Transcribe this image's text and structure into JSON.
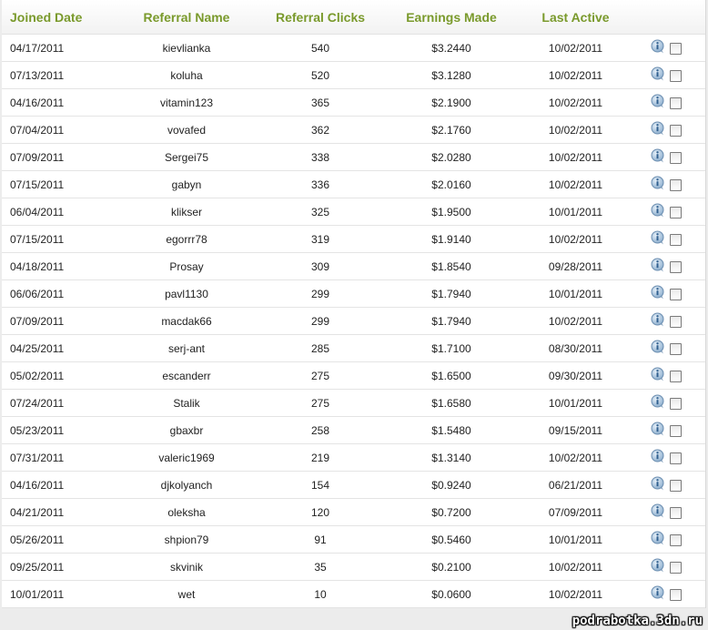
{
  "columns": {
    "joined": "Joined Date",
    "name": "Referral Name",
    "clicks": "Referral Clicks",
    "earnings": "Earnings Made",
    "active": "Last Active"
  },
  "rows": [
    {
      "joined": "04/17/2011",
      "name": "kievlianka",
      "clicks": "540",
      "earnings": "$3.2440",
      "active": "10/02/2011"
    },
    {
      "joined": "07/13/2011",
      "name": "koluha",
      "clicks": "520",
      "earnings": "$3.1280",
      "active": "10/02/2011"
    },
    {
      "joined": "04/16/2011",
      "name": "vitamin123",
      "clicks": "365",
      "earnings": "$2.1900",
      "active": "10/02/2011"
    },
    {
      "joined": "07/04/2011",
      "name": "vovafed",
      "clicks": "362",
      "earnings": "$2.1760",
      "active": "10/02/2011"
    },
    {
      "joined": "07/09/2011",
      "name": "Sergei75",
      "clicks": "338",
      "earnings": "$2.0280",
      "active": "10/02/2011"
    },
    {
      "joined": "07/15/2011",
      "name": "gabyn",
      "clicks": "336",
      "earnings": "$2.0160",
      "active": "10/02/2011"
    },
    {
      "joined": "06/04/2011",
      "name": "klikser",
      "clicks": "325",
      "earnings": "$1.9500",
      "active": "10/01/2011"
    },
    {
      "joined": "07/15/2011",
      "name": "egorrr78",
      "clicks": "319",
      "earnings": "$1.9140",
      "active": "10/02/2011"
    },
    {
      "joined": "04/18/2011",
      "name": "Prosay",
      "clicks": "309",
      "earnings": "$1.8540",
      "active": "09/28/2011"
    },
    {
      "joined": "06/06/2011",
      "name": "pavl1130",
      "clicks": "299",
      "earnings": "$1.7940",
      "active": "10/01/2011"
    },
    {
      "joined": "07/09/2011",
      "name": "macdak66",
      "clicks": "299",
      "earnings": "$1.7940",
      "active": "10/02/2011"
    },
    {
      "joined": "04/25/2011",
      "name": "serj-ant",
      "clicks": "285",
      "earnings": "$1.7100",
      "active": "08/30/2011"
    },
    {
      "joined": "05/02/2011",
      "name": "escanderr",
      "clicks": "275",
      "earnings": "$1.6500",
      "active": "09/30/2011"
    },
    {
      "joined": "07/24/2011",
      "name": "Stalik",
      "clicks": "275",
      "earnings": "$1.6580",
      "active": "10/01/2011"
    },
    {
      "joined": "05/23/2011",
      "name": "gbaxbr",
      "clicks": "258",
      "earnings": "$1.5480",
      "active": "09/15/2011"
    },
    {
      "joined": "07/31/2011",
      "name": "valeric1969",
      "clicks": "219",
      "earnings": "$1.3140",
      "active": "10/02/2011"
    },
    {
      "joined": "04/16/2011",
      "name": "djkolyanch",
      "clicks": "154",
      "earnings": "$0.9240",
      "active": "06/21/2011"
    },
    {
      "joined": "04/21/2011",
      "name": "oleksha",
      "clicks": "120",
      "earnings": "$0.7200",
      "active": "07/09/2011"
    },
    {
      "joined": "05/26/2011",
      "name": "shpion79",
      "clicks": "91",
      "earnings": "$0.5460",
      "active": "10/01/2011"
    },
    {
      "joined": "09/25/2011",
      "name": "skvinik",
      "clicks": "35",
      "earnings": "$0.2100",
      "active": "10/02/2011"
    },
    {
      "joined": "10/01/2011",
      "name": "wet",
      "clicks": "10",
      "earnings": "$0.0600",
      "active": "10/02/2011"
    }
  ],
  "row_icon": "info-icon",
  "row_control": "checkbox-unchecked",
  "colors": {
    "header_text": "#7a9a2c",
    "row_border": "#e4e4e4",
    "background": "#ececec"
  },
  "watermark": "podrabotka.3dn.ru"
}
